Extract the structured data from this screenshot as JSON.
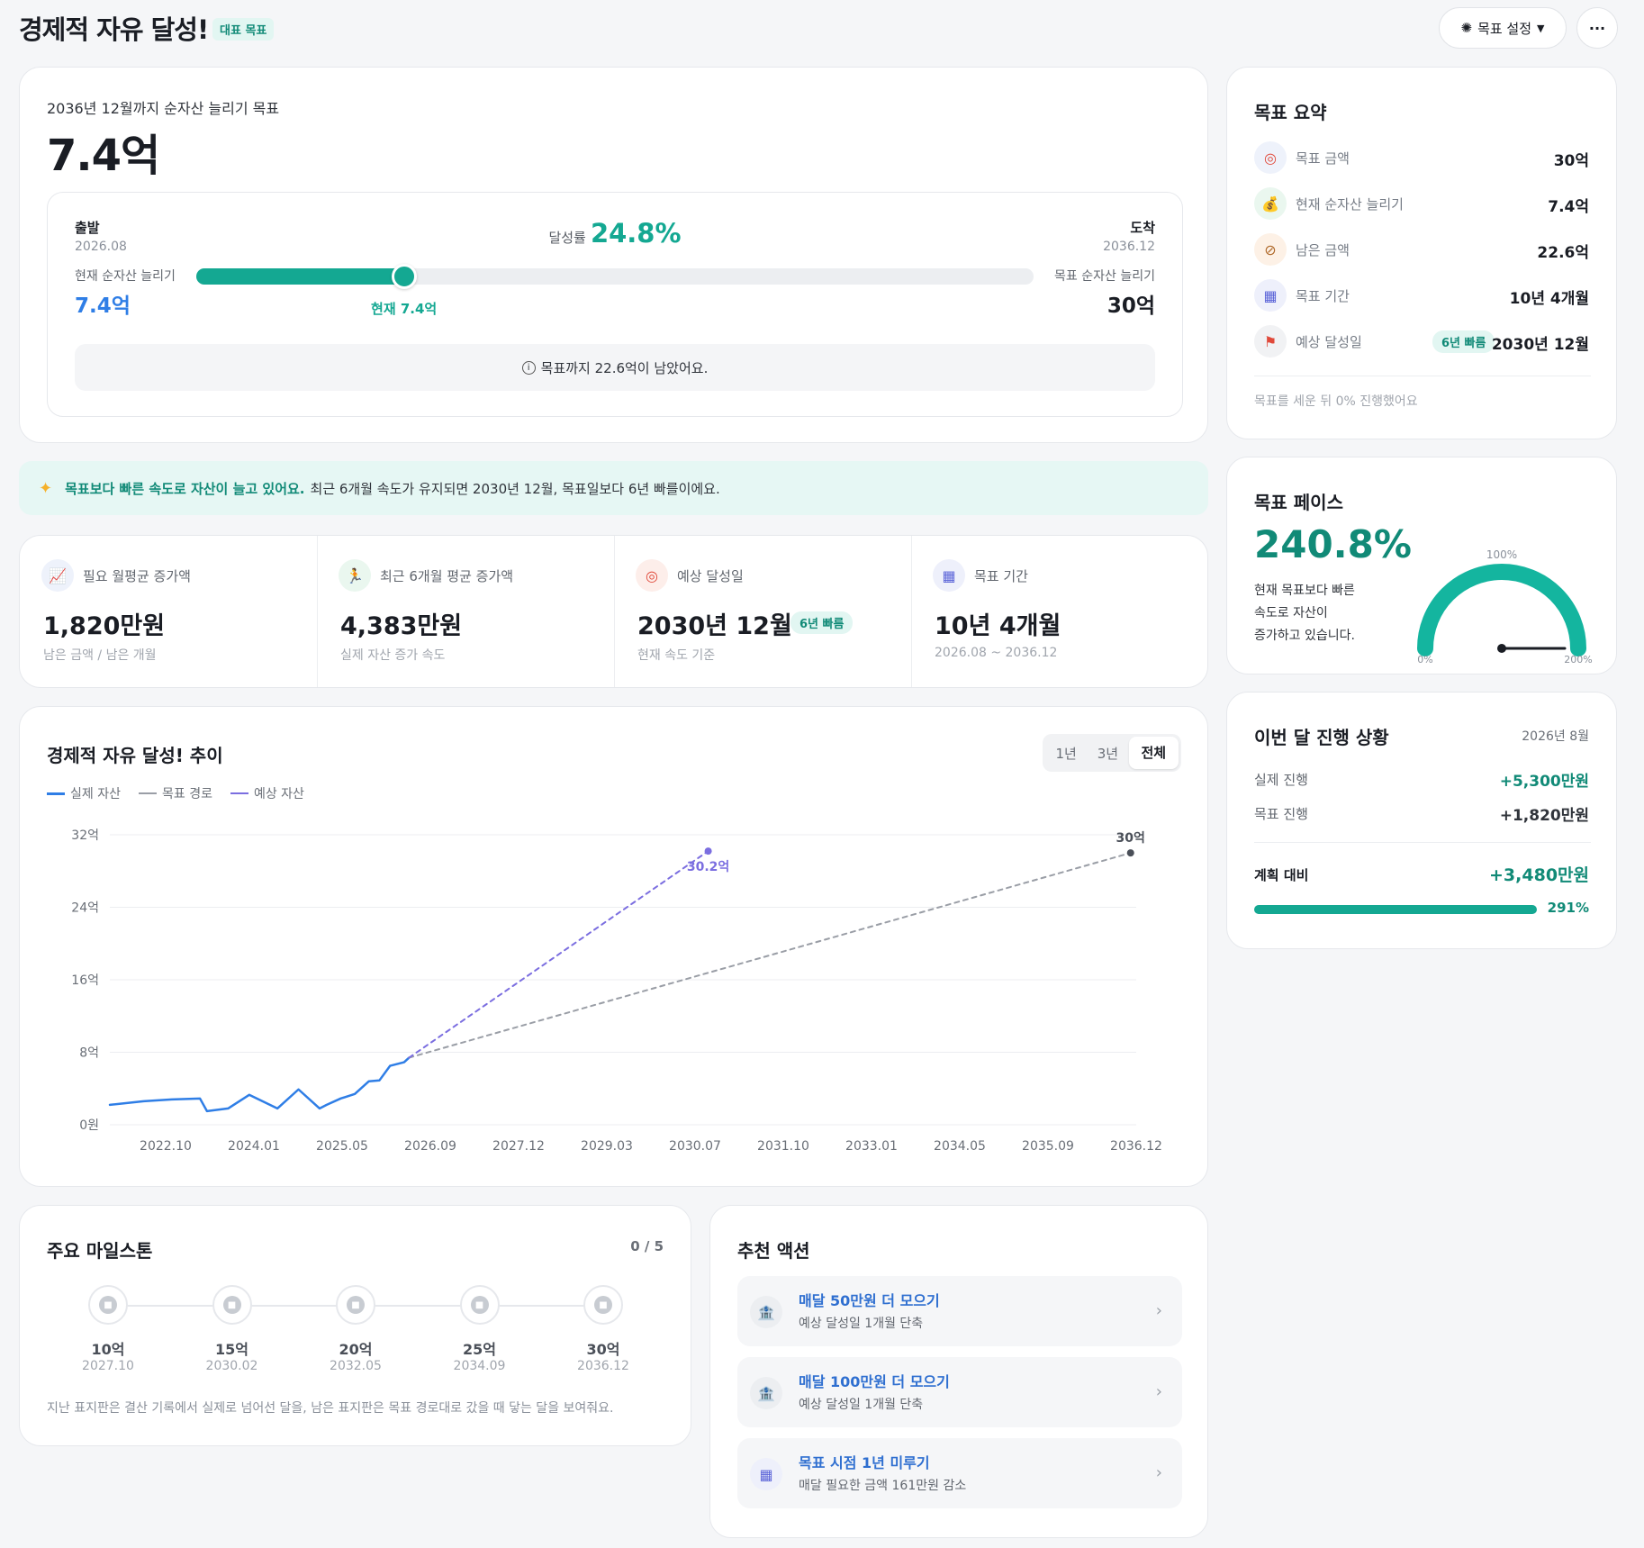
{
  "header": {
    "title": "경제적 자유 달성!",
    "badge": "대표 목표",
    "settings_button": "목표 설정",
    "more_button": "···"
  },
  "hero": {
    "subtitle": "2036년 12월까지 순자산 늘리기 목표",
    "amount": "7.4억",
    "start_label": "출발",
    "start_date": "2026.08",
    "end_label": "도착",
    "end_date": "2036.12",
    "rate_label": "달성률",
    "rate_value": "24.8%",
    "current_label": "현재 순자산 늘리기",
    "current_value": "7.4억",
    "target_label": "목표 순자산 늘리기",
    "target_value": "30억",
    "marker_label": "현재 7.4억",
    "progress": 0.248,
    "info_text": "목표까지 22.6억이 남았어요."
  },
  "banner": {
    "highlight": "목표보다 빠른 속도로 자산이 늘고 있어요.",
    "text": "최근 6개월 속도가 유지되면 2030년 12월, 목표일보다 6년 빠를이에요."
  },
  "stats": [
    {
      "icon": "chart-up-icon",
      "label": "필요 월평균 증가액",
      "value": "1,820만원",
      "sub": "남은 금액 / 남은 개월",
      "pill": ""
    },
    {
      "icon": "runner-icon",
      "label": "최근 6개월 평균 증가액",
      "value": "4,383만원",
      "sub": "실제 자산 증가 속도",
      "pill": ""
    },
    {
      "icon": "target-icon",
      "label": "예상 달성일",
      "value": "2030년 12월",
      "sub": "현재 속도 기준",
      "pill": "6년 빠름"
    },
    {
      "icon": "calendar-icon",
      "label": "목표 기간",
      "value": "10년 4개월",
      "sub": "2026.08 ~ 2036.12",
      "pill": ""
    }
  ],
  "chart": {
    "title": "경제적 자유 달성! 추이",
    "ranges": [
      "1년",
      "3년",
      "전체"
    ],
    "active_range": "전체",
    "legend": [
      "실제 자산",
      "목표 경로",
      "예상 자산"
    ]
  },
  "chart_data": {
    "type": "line",
    "title": "경제적 자유 달성! 추이",
    "y_ticks": [
      "0원",
      "8억",
      "16억",
      "24억",
      "32억"
    ],
    "ylim": [
      0,
      32
    ],
    "x_ticks": [
      "2022.10",
      "2024.01",
      "2025.05",
      "2026.09",
      "2027.12",
      "2029.03",
      "2030.07",
      "2031.10",
      "2033.01",
      "2034.05",
      "2035.09",
      "2036.12"
    ],
    "xlim": [
      2022.42,
      2037.0
    ],
    "series": [
      {
        "name": "실제 자산",
        "color": "#2f7ee6",
        "dashed": false,
        "x": [
          2022.42,
          2022.9,
          2023.3,
          2023.7,
          2023.8,
          2024.1,
          2024.4,
          2024.8,
          2025.1,
          2025.4,
          2025.5,
          2025.7,
          2025.9,
          2026.1,
          2026.25,
          2026.4,
          2026.6,
          2026.67
        ],
        "y": [
          2.2,
          2.6,
          2.8,
          2.9,
          1.5,
          1.8,
          3.3,
          1.8,
          3.9,
          1.8,
          2.2,
          2.9,
          3.4,
          4.8,
          4.9,
          6.5,
          6.9,
          7.4
        ]
      },
      {
        "name": "목표 경로",
        "color": "#9a9ea6",
        "dashed": true,
        "x": [
          2026.67,
          2036.92
        ],
        "y": [
          7.4,
          30
        ]
      },
      {
        "name": "예상 자산",
        "color": "#7b6ee0",
        "dashed": true,
        "x": [
          2026.67,
          2030.92
        ],
        "y": [
          7.4,
          30.2
        ]
      }
    ],
    "annotations": [
      {
        "text": "30.2억",
        "x": 2030.92,
        "y": 30.2,
        "color": "#7b6ee0"
      },
      {
        "text": "30억",
        "x": 2036.92,
        "y": 30,
        "color": "#4a4f58"
      }
    ],
    "grid": true
  },
  "milestones": {
    "title": "주요 마일스톤",
    "count": "0 / 5",
    "items": [
      {
        "value": "10억",
        "date": "2027.10"
      },
      {
        "value": "15억",
        "date": "2030.02"
      },
      {
        "value": "20억",
        "date": "2032.05"
      },
      {
        "value": "25억",
        "date": "2034.09"
      },
      {
        "value": "30억",
        "date": "2036.12"
      }
    ],
    "note": "지난 표지판은 결산 기록에서 실제로 넘어선 달을, 남은 표지판은 목표 경로대로 갔을 때 닿는 달을 보여줘요."
  },
  "actions": {
    "title": "추천 액션",
    "items": [
      {
        "icon": "bank-icon",
        "title": "매달 50만원 더 모으기",
        "sub": "예상 달성일 1개월 단축"
      },
      {
        "icon": "bank-icon",
        "title": "매달 100만원 더 모으기",
        "sub": "예상 달성일 1개월 단축"
      },
      {
        "icon": "calendar-icon",
        "title": "목표 시점 1년 미루기",
        "sub": "매달 필요한 금액 161만원 감소"
      }
    ]
  },
  "summary": {
    "title": "목표 요약",
    "rows": [
      {
        "icon": "target-icon",
        "label": "목표 금액",
        "value": "30억"
      },
      {
        "icon": "moneybag-icon",
        "label": "현재 순자산 늘리기",
        "value": "7.4억"
      },
      {
        "icon": "compass-icon",
        "label": "남은 금액",
        "value": "22.6억"
      },
      {
        "icon": "calendar-icon",
        "label": "목표 기간",
        "value": "10년 4개월"
      },
      {
        "icon": "flag-icon",
        "label": "예상 달성일",
        "value": "2030년 12월",
        "pill": "6년 빠름"
      }
    ],
    "footer": "목표를 세운 뒤 0% 진행했어요"
  },
  "pace": {
    "title": "목표 페이스",
    "value": "240.8%",
    "desc_line1": "현재 목표보다 빠른",
    "desc_line2": "속도로 자산이",
    "desc_line3": "증가하고 있습니다.",
    "gauge_top": "100%",
    "gauge_left": "0%",
    "gauge_right": "200%",
    "pace_percent": 240.8
  },
  "month": {
    "title": "이번 달 진행 상황",
    "date": "2026년 8월",
    "actual_label": "실제 진행",
    "actual_value": "+5,300만원",
    "target_label": "목표 진행",
    "target_value": "+1,820만원",
    "vs_label": "계획 대비",
    "vs_value": "+3,480만원",
    "percent": "291%",
    "bar_fraction": 1.0
  },
  "colors": {
    "accent": "#14a892",
    "blue": "#2f7ee6",
    "purple": "#7b6ee0"
  }
}
